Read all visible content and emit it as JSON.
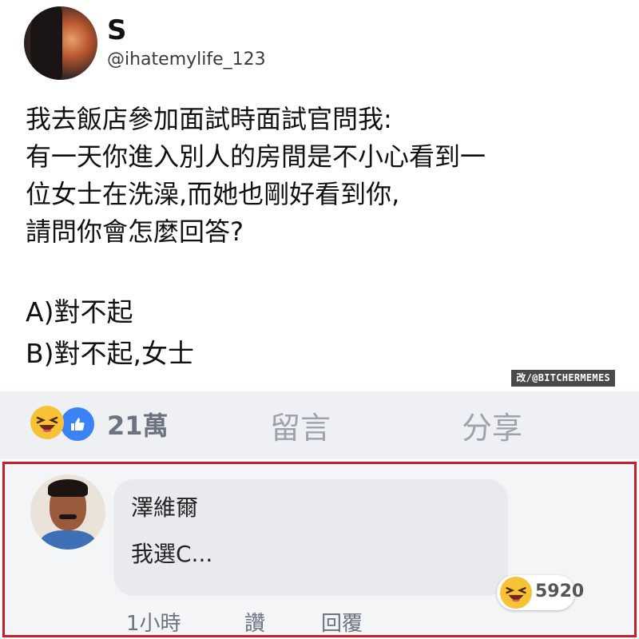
{
  "post": {
    "author_name": "S",
    "author_handle": "@ihatemylife_123",
    "text": "我去飯店參加面試時面試官問我:\n有一天你進入別人的房間是不小心看到一\n位女士在洗澡,而她也剛好看到你,\n請問你會怎麼回答?",
    "options": [
      "A)對不起",
      "B)對不起,女士"
    ],
    "watermark": "改/@BITCHERMEMES"
  },
  "action_bar": {
    "reaction_icons": [
      "haha-icon",
      "like-icon"
    ],
    "reaction_count": "21萬",
    "comment_label": "留言",
    "share_label": "分享"
  },
  "comment": {
    "author_name": "澤維爾",
    "text": "我選C...",
    "reaction_icon": "haha-icon",
    "reaction_count": "5920",
    "time": "1小時",
    "like_label": "讚",
    "reply_label": "回覆",
    "highlight_color": "#c81e2a"
  }
}
